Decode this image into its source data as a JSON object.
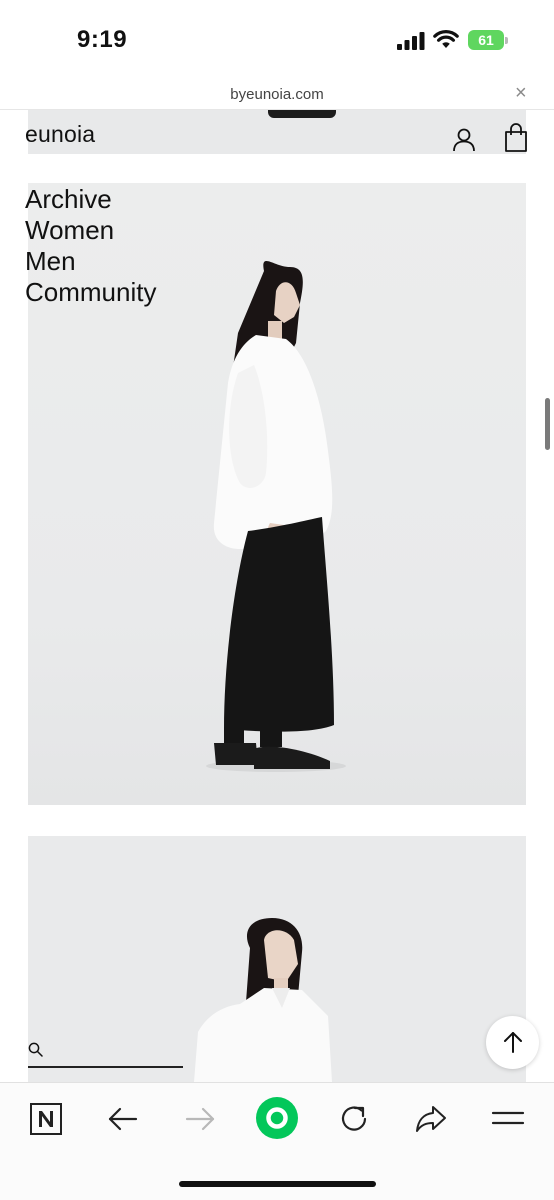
{
  "status_bar": {
    "time": "9:19",
    "battery_percent": "61",
    "icons": [
      "signal-icon",
      "wifi-icon",
      "battery-icon"
    ]
  },
  "browser": {
    "url": "byeunoia.com",
    "close_icon": "close-icon"
  },
  "site": {
    "logo": "eunoia",
    "header_icons": [
      "account-icon",
      "shopping-bag-icon"
    ],
    "nav": [
      "Archive",
      "Women",
      "Men",
      "Community"
    ],
    "search_icon": "search-icon",
    "back_to_top_icon": "arrow-up-icon"
  },
  "toolbar": {
    "items": [
      "naver-icon",
      "back-arrow-icon",
      "forward-arrow-icon",
      "green-dot-icon",
      "refresh-icon",
      "share-icon",
      "menu-icon"
    ],
    "accent": "#03c75a"
  }
}
